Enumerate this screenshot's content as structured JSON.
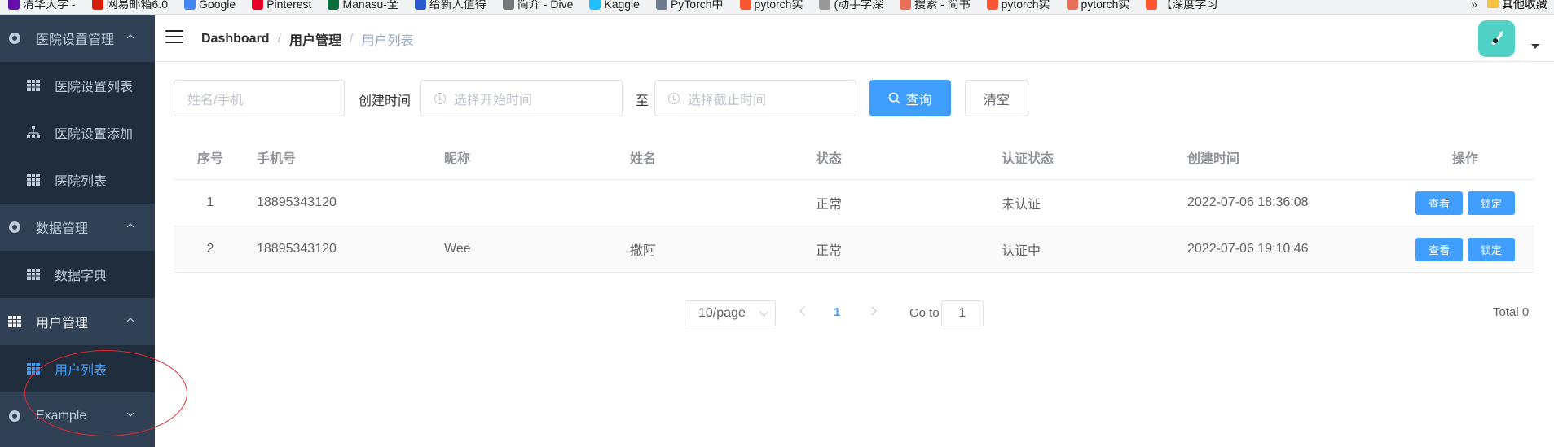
{
  "bookmarks": [
    {
      "label": "清华大学 -",
      "color": "#6a0dad"
    },
    {
      "label": "网易邮箱6.0",
      "color": "#d81e06"
    },
    {
      "label": "Google",
      "color": "#4285f4"
    },
    {
      "label": "Pinterest",
      "color": "#e60023"
    },
    {
      "label": "Manasu-全",
      "color": "#0b6b3a"
    },
    {
      "label": "给新人值得",
      "color": "#2a59d1"
    },
    {
      "label": "简介 - Dive",
      "color": "#777777"
    },
    {
      "label": "Kaggle",
      "color": "#20beff"
    },
    {
      "label": "PyTorch中",
      "color": "#6d7b8d"
    },
    {
      "label": "pytorch实",
      "color": "#fc5531"
    },
    {
      "label": "(动手学深",
      "color": "#999999"
    },
    {
      "label": "搜索 - 简书",
      "color": "#ea6f5a"
    },
    {
      "label": "pytorch实",
      "color": "#fc5531"
    },
    {
      "label": "pytorch实",
      "color": "#ea6f5a"
    },
    {
      "label": "【深度学习",
      "color": "#fc5531"
    }
  ],
  "bookmarks_more": "»",
  "bookmarks_other": "其他收藏",
  "sidebar": {
    "groups": [
      {
        "label": "医院设置管理",
        "icon": "settings-icon",
        "items": [
          {
            "label": "医院设置列表",
            "icon": "table-icon"
          },
          {
            "label": "医院设置添加",
            "icon": "tree-icon"
          },
          {
            "label": "医院列表",
            "icon": "table-icon"
          }
        ]
      },
      {
        "label": "数据管理",
        "icon": "settings-icon",
        "items": [
          {
            "label": "数据字典",
            "icon": "table-icon"
          }
        ]
      },
      {
        "label": "用户管理",
        "icon": "table-icon",
        "items": [
          {
            "label": "用户列表",
            "icon": "table-icon",
            "active": true
          }
        ]
      },
      {
        "label": "Example",
        "icon": "settings-icon",
        "items": []
      }
    ]
  },
  "breadcrumb": {
    "home": "Dashboard",
    "parent": "用户管理",
    "current": "用户列表",
    "separator": "/"
  },
  "search": {
    "name_placeholder": "姓名/手机",
    "created_label": "创建时间",
    "start_placeholder": "选择开始时间",
    "to_label": "至",
    "end_placeholder": "选择截止时间",
    "query_label": "查询",
    "clear_label": "清空"
  },
  "table": {
    "headers": [
      "序号",
      "手机号",
      "昵称",
      "姓名",
      "状态",
      "认证状态",
      "创建时间",
      "操作"
    ],
    "rows": [
      {
        "index": "1",
        "phone": "18895343120",
        "nickname": "",
        "name": "",
        "status": "正常",
        "auth": "未认证",
        "created": "2022-07-06 18:36:08"
      },
      {
        "index": "2",
        "phone": "18895343120",
        "nickname": "Wee",
        "name": "撒阿",
        "status": "正常",
        "auth": "认证中",
        "created": "2022-07-06 19:10:46"
      }
    ],
    "view_label": "查看",
    "lock_label": "锁定"
  },
  "pagination": {
    "page_size": "10/page",
    "current_page": "1",
    "goto_label": "Go to",
    "goto_value": "1",
    "total": "Total 0"
  },
  "colors": {
    "primary": "#409eff",
    "sidebar_bg": "#304156",
    "submenu_bg": "#1f2d3d",
    "annotation": "#e0282e"
  }
}
